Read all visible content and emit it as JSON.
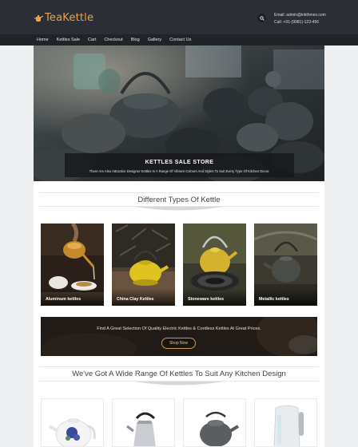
{
  "header": {
    "brand": "TeaKettle",
    "email": "Email: admin@inkthmes.com",
    "call": "Call: +91-(9981)-123-456",
    "colors": {
      "brand": "#e8a34c",
      "topbar": "#2b2f35",
      "navbar": "#202328"
    }
  },
  "nav": {
    "items": [
      "Home",
      "Kettles Sale",
      "Cart",
      "Checkout",
      "Blog",
      "Gallery",
      "Contact Us"
    ]
  },
  "hero": {
    "title": "KETTLES SALE STORE",
    "subtitle": "There Are Also Attractive Designer Kettles In A Range Of Vibrant Colours And Styles To Suit Every Type Of Kitchen Decor."
  },
  "types_section": {
    "title": "Different Types Of Kettle",
    "cards": [
      {
        "label": "Aluminum kettles",
        "icon": "aluminum-kettle-photo"
      },
      {
        "label": "China Clay Kettles",
        "icon": "clay-kettle-photo"
      },
      {
        "label": "Stoneware kettles",
        "icon": "stoneware-kettle-photo"
      },
      {
        "label": "Metallic kettles",
        "icon": "metallic-kettle-photo"
      }
    ]
  },
  "banner": {
    "text": "Find A Great Selection Of Quality Electric Kettles & Cordless Kettles At Great Prices.",
    "button": "Shop Now"
  },
  "range_section": {
    "title": "We've Got A Wide Range Of Kettles To Suit Any Kitchen Design",
    "products": [
      {
        "icon": "floral-ceramic-kettle"
      },
      {
        "icon": "steel-whistling-kettle"
      },
      {
        "icon": "camping-kettle"
      },
      {
        "icon": "glass-electric-kettle"
      }
    ]
  }
}
